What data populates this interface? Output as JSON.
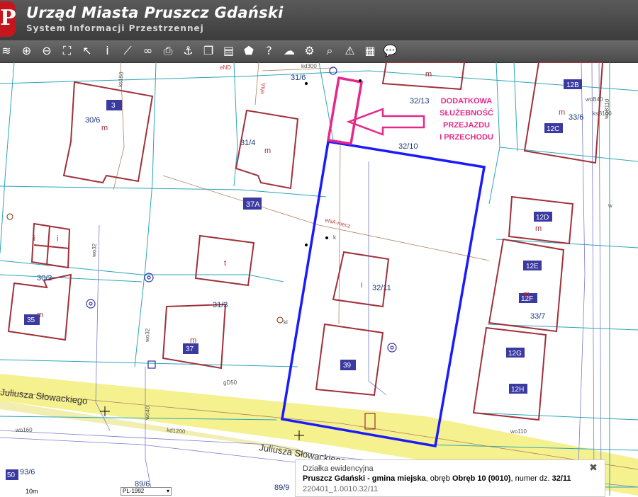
{
  "header": {
    "logo_letter": "P",
    "title": "Urząd Miasta Pruszcz Gdański",
    "subtitle": "System Informacji Przestrzennej"
  },
  "toolbar": {
    "tools": [
      {
        "name": "layers-icon",
        "glyph": "≋"
      },
      {
        "name": "zoom-in-icon",
        "glyph": "⊕"
      },
      {
        "name": "zoom-out-icon",
        "glyph": "⊖"
      },
      {
        "name": "zoom-extent-icon",
        "glyph": "⛶"
      },
      {
        "name": "select-pointer-icon",
        "glyph": "↖"
      },
      {
        "name": "info-icon",
        "glyph": "i"
      },
      {
        "name": "measure-icon",
        "glyph": "⟋"
      },
      {
        "name": "link-icon",
        "glyph": "∞"
      },
      {
        "name": "print-icon",
        "glyph": "⎙"
      },
      {
        "name": "anchor-icon",
        "glyph": "⚓"
      },
      {
        "name": "copy-icon",
        "glyph": "❐"
      },
      {
        "name": "layout-icon",
        "glyph": "▤"
      },
      {
        "name": "map-sheet-icon",
        "glyph": "⬟"
      },
      {
        "name": "help-icon",
        "glyph": "?"
      },
      {
        "name": "cloud-download-icon",
        "glyph": "☁"
      },
      {
        "name": "settings-icon",
        "glyph": "⚙"
      },
      {
        "name": "search-zoom-icon",
        "glyph": "⌕"
      },
      {
        "name": "warning-triangle-icon",
        "glyph": "⚠"
      },
      {
        "name": "color-grid-icon",
        "glyph": "▦"
      },
      {
        "name": "comment-icon",
        "glyph": "💬"
      }
    ]
  },
  "map": {
    "parcel_labels": [
      "31/6",
      "32/13",
      "32/10",
      "30/6",
      "31/4",
      "33/6",
      "37A",
      "30/2",
      "32/11",
      "31/3",
      "33/7",
      "89/6",
      "93/6",
      "89/9"
    ],
    "building_numbers": [
      "3",
      "12B",
      "12C",
      "12D",
      "12E",
      "12F",
      "12G",
      "12H",
      "35",
      "37",
      "39",
      "50"
    ],
    "use_codes": [
      "m",
      "i",
      "t"
    ],
    "street_names": [
      "Juliusza Słowackiego",
      "Juliusza Słowackiego"
    ],
    "utility_labels": [
      "eNA-niecz",
      "eND",
      "eNA",
      "ks150",
      "kd300",
      "ksB160",
      "woB40",
      "woB110",
      "wo110",
      "wo160",
      "wo32",
      "wo40",
      "kd1200",
      "gD50",
      "kl",
      "k",
      "w"
    ],
    "annotation": [
      "DODATKOWA",
      "SŁUŻEBNOŚĆ",
      "PRZEJAZDU",
      "I PRZECHODU"
    ],
    "colors": {
      "parcel_outline": "#1a1aff",
      "annotation": "#e6288a",
      "building": "#a0303a",
      "grid": "#2aa6b8",
      "street": "#f3ee7a"
    }
  },
  "info_panel": {
    "heading": "Działka ewidencyjna",
    "place": "Pruszcz Gdański - gmina miejska",
    "precinct_prefix": ", obręb ",
    "precinct": "Obręb 10 (0010)",
    "number_prefix": ", numer dz.",
    "number": "32/11",
    "identifier": "220401_1.0010.32/11",
    "close_glyph": "✖"
  },
  "scale": {
    "label": "10m"
  },
  "crs": {
    "selected": "PL-1992"
  }
}
